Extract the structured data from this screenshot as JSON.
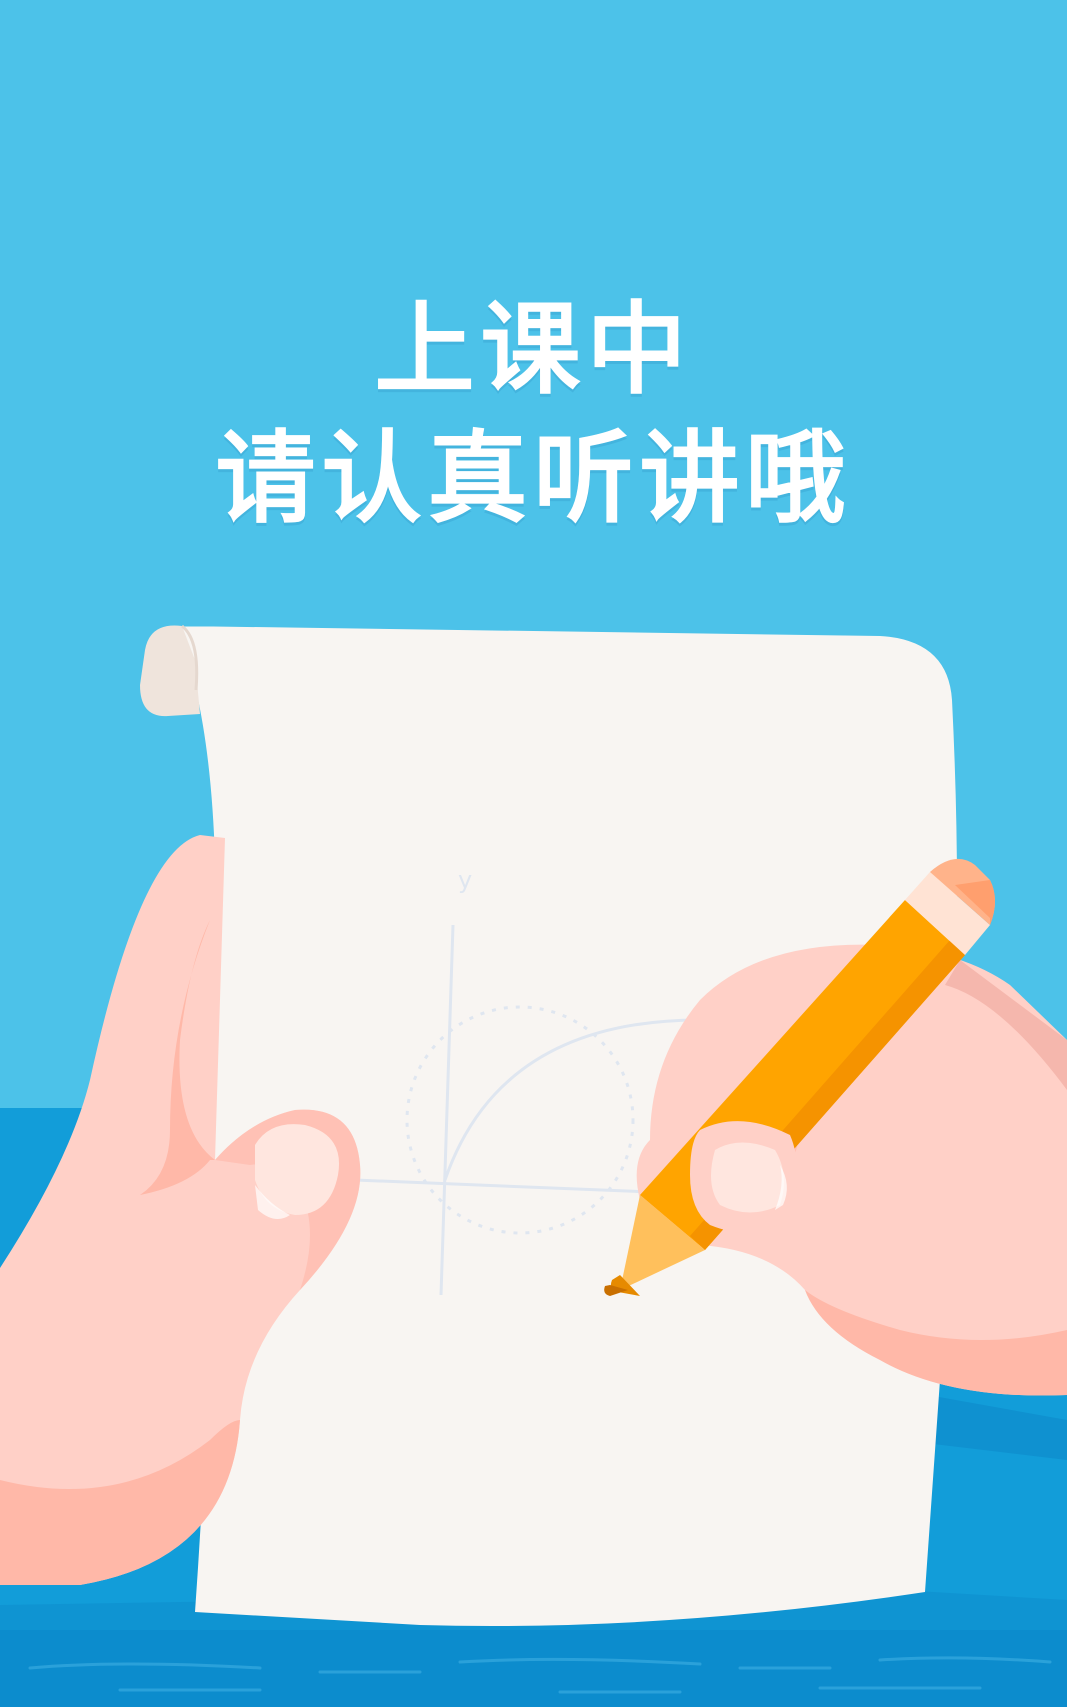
{
  "screen": {
    "name": "class-in-progress-splash",
    "background_color": "#4cc2e9",
    "sea_color": "#129dd9",
    "sea_dark_color": "#0c86c7"
  },
  "headline": {
    "line1": "上课中",
    "line2": "请认真听讲哦"
  },
  "illustration": {
    "paper_color": "#f8f5f2",
    "paper_curl_color": "#efe4dc",
    "skin_color": "#ffd0c7",
    "skin_shadow_color": "#ffb8a8",
    "pencil_color": "#ffa400",
    "pencil_dark_color": "#f59300",
    "pencil_eraser_color": "#ffb38a",
    "sketch_axis_label": "y"
  }
}
